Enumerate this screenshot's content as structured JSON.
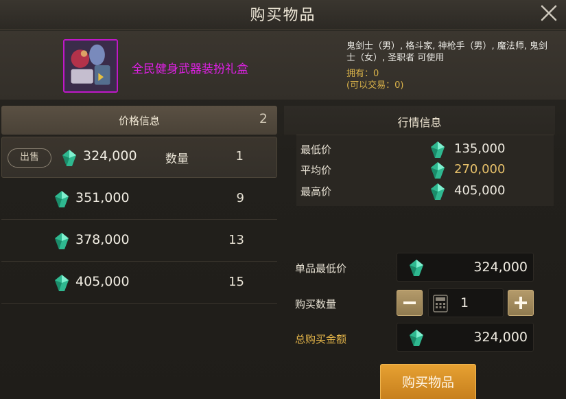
{
  "window": {
    "title": "购买物品"
  },
  "item": {
    "name": "全民健身武器装扮礼盒",
    "usable_by": "鬼剑士（男）, 格斗家, 神枪手（男）, 魔法师, 鬼剑士（女）, 圣职者 可使用",
    "owned": "拥有：0",
    "tradable": "(可以交易：0)",
    "name_color": "#e020e6",
    "border_color": "#c018c8"
  },
  "price_list": {
    "header": "价格信息",
    "count": "2",
    "sell_badge": "出售",
    "qty_label": "数量",
    "rows": [
      {
        "price": "324,000",
        "qty": "1"
      },
      {
        "price": "351,000",
        "qty": "9"
      },
      {
        "price": "378,000",
        "qty": "13"
      },
      {
        "price": "405,000",
        "qty": "15"
      }
    ]
  },
  "market": {
    "header": "行情信息",
    "min_label": "最低价",
    "min": "135,000",
    "avg_label": "平均价",
    "avg": "270,000",
    "max_label": "最高价",
    "max": "405,000"
  },
  "purchase": {
    "unit_label": "单品最低价",
    "unit_price": "324,000",
    "qty_label": "购买数量",
    "qty": "1",
    "total_label": "总购买金额",
    "total": "324,000",
    "buy_label": "购买物品"
  },
  "icons": {
    "currency": "gem-icon",
    "close": "close-icon",
    "minus": "minus-icon",
    "plus": "plus-icon",
    "calculator": "calculator-icon"
  },
  "colors": {
    "gem": "#3fd6a8",
    "accent_gold": "#e8b84a",
    "buy_button": "#d98e26"
  }
}
